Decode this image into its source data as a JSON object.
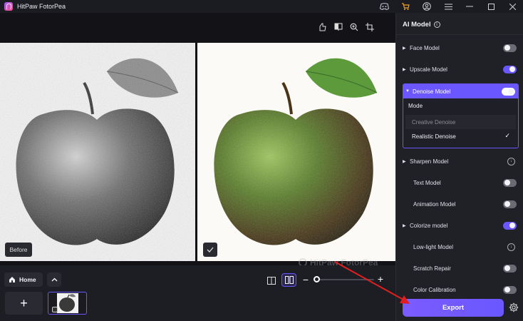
{
  "window": {
    "title": "HitPaw FotorPea"
  },
  "canvas": {
    "before_label": "Before",
    "watermark": "HitPaw FotorPea"
  },
  "bottom": {
    "home_label": "Home",
    "add_label": "+"
  },
  "sidebar": {
    "title": "AI Model",
    "models": [
      {
        "label": "Face Model",
        "enabled": false
      },
      {
        "label": "Upscale Model",
        "enabled": true
      },
      {
        "label": "Denoise Model",
        "enabled": true,
        "expanded": true
      },
      {
        "label": "Sharpen Model",
        "enabled": false
      },
      {
        "label": "Text Model",
        "enabled": false
      },
      {
        "label": "Animation Model",
        "enabled": false
      },
      {
        "label": "Colorize model",
        "enabled": true
      },
      {
        "label": "Low-light Model",
        "enabled": false
      },
      {
        "label": "Scratch Repair",
        "enabled": false
      },
      {
        "label": "Color Calibration",
        "enabled": false
      }
    ],
    "denoise": {
      "mode_label": "Mode",
      "options": [
        "Creative Denoise",
        "Realistic Denoise"
      ],
      "selected": "Realistic Denoise"
    },
    "export_label": "Export"
  },
  "colors": {
    "accent": "#6a57ff",
    "annotation": "#e02020"
  }
}
